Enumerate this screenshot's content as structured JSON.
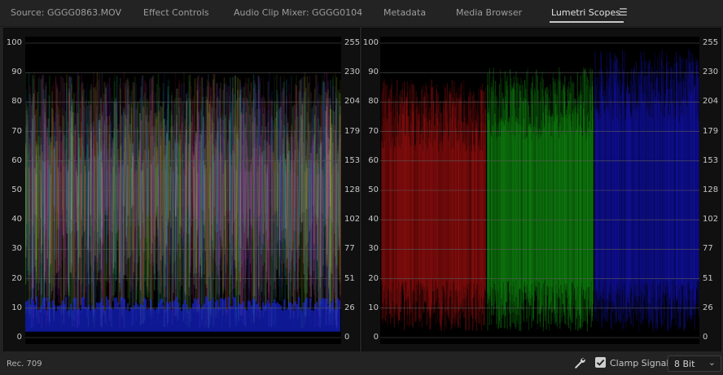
{
  "tabs": [
    {
      "label": "Source: GGGG0863.MOV"
    },
    {
      "label": "Effect Controls"
    },
    {
      "label": "Audio Clip Mixer: GGGG0104"
    },
    {
      "label": "Metadata"
    },
    {
      "label": "Media Browser"
    },
    {
      "label": "Lumetri Scopes",
      "active": true
    }
  ],
  "menu_icon": "hamburger-menu-icon",
  "scopes": {
    "left_percent_ticks": [
      "100",
      "90",
      "80",
      "70",
      "60",
      "50",
      "40",
      "30",
      "20",
      "10",
      "0"
    ],
    "left_8bit_ticks": [
      "255",
      "230",
      "204",
      "179",
      "153",
      "128",
      "102",
      "77",
      "51",
      "26",
      "0"
    ],
    "right_percent_ticks": [
      "100",
      "90",
      "80",
      "70",
      "60",
      "50",
      "40",
      "30",
      "20",
      "10",
      "0"
    ],
    "right_8bit_ticks": [
      "255",
      "230",
      "204",
      "179",
      "153",
      "128",
      "102",
      "77",
      "51",
      "26",
      "0"
    ]
  },
  "footer": {
    "color_space": "Rec. 709",
    "wrench_icon": "wrench-icon",
    "clamp_signal_label": "Clamp Signal",
    "clamp_signal_checked": true,
    "bit_depth": "8 Bit"
  },
  "colors": {
    "background": "#232323",
    "scope_bg": "#000000",
    "red": "#e01010",
    "green": "#18d018",
    "blue": "#1a1ae0"
  }
}
